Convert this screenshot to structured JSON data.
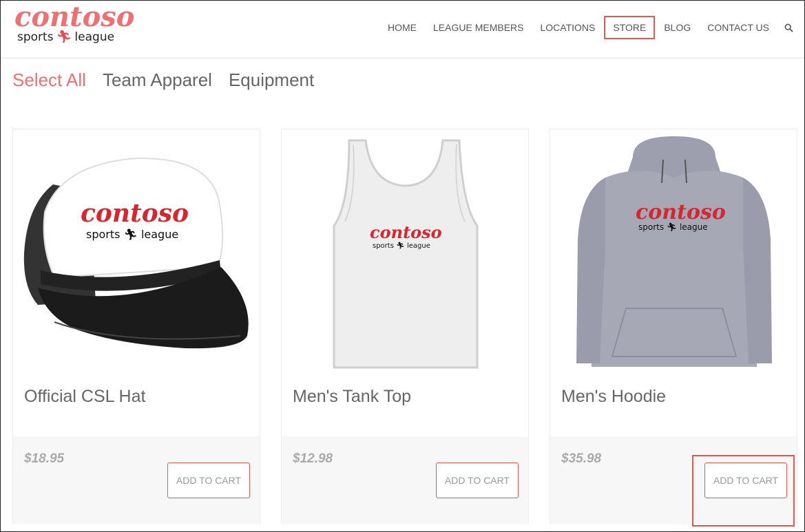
{
  "brand": {
    "name": "contoso",
    "tagline_left": "sports",
    "tagline_right": "league",
    "color": "#ee7070"
  },
  "nav": {
    "items": [
      {
        "label": "HOME"
      },
      {
        "label": "LEAGUE MEMBERS"
      },
      {
        "label": "LOCATIONS"
      },
      {
        "label": "STORE",
        "active": true
      },
      {
        "label": "BLOG"
      },
      {
        "label": "CONTACT US"
      }
    ],
    "search_icon": "search-icon"
  },
  "filters": [
    {
      "label": "Select All",
      "active": true
    },
    {
      "label": "Team Apparel"
    },
    {
      "label": "Equipment"
    }
  ],
  "products": [
    {
      "title": "Official CSL Hat",
      "price": "$18.95",
      "button": "ADD TO CART",
      "image": "cap-image"
    },
    {
      "title": "Men's Tank Top",
      "price": "$12.98",
      "button": "ADD TO CART",
      "image": "tank-top-image"
    },
    {
      "title": "Men's Hoodie",
      "price": "$35.98",
      "button": "ADD TO CART",
      "image": "hoodie-image",
      "highlighted": true
    }
  ],
  "accent_color": "#e8574b"
}
